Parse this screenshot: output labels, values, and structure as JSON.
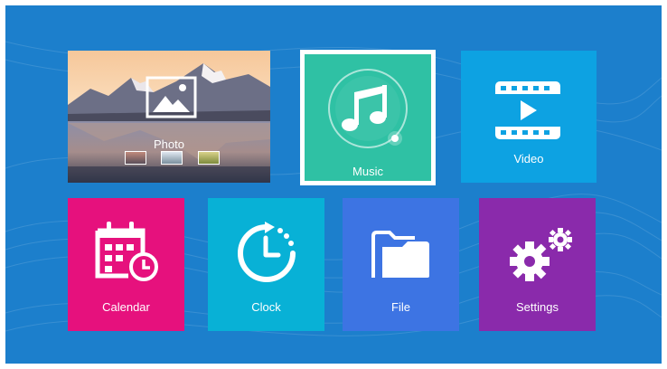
{
  "screen": {
    "background": "#1c7fcc",
    "tiles": {
      "photo": {
        "label": "Photo",
        "icon": "landscape-icon"
      },
      "music": {
        "label": "Music",
        "icon": "music-note-icon",
        "color": "#2fc1a4",
        "selected": true
      },
      "video": {
        "label": "Video",
        "icon": "film-play-icon",
        "color": "#0da2e2"
      },
      "calendar": {
        "label": "Calendar",
        "icon": "calendar-clock-icon",
        "color": "#e6117d"
      },
      "clock": {
        "label": "Clock",
        "icon": "clock-icon",
        "color": "#08b1d6"
      },
      "file": {
        "label": "File",
        "icon": "folder-icon",
        "color": "#3d74e3"
      },
      "settings": {
        "label": "Settings",
        "icon": "gears-icon",
        "color": "#8a2aab"
      }
    }
  }
}
